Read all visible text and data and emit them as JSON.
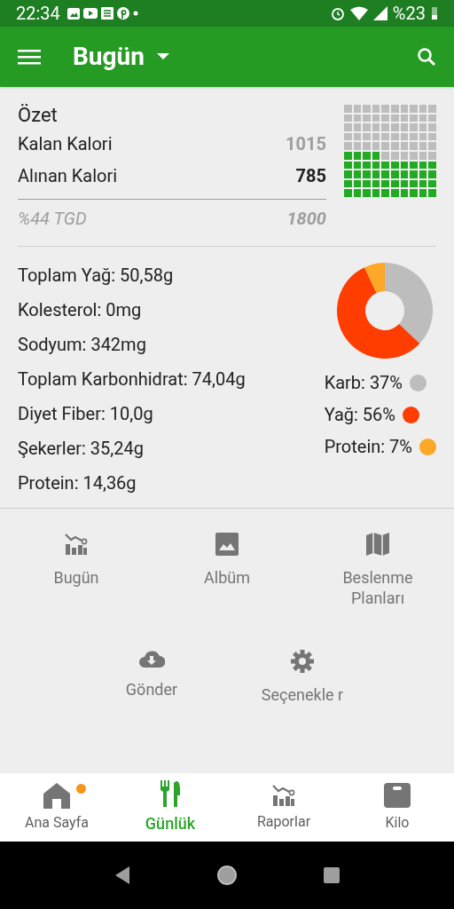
{
  "status_bar": {
    "time": "22:34",
    "battery": "%23"
  },
  "app_bar": {
    "title": "Bugün"
  },
  "summary": {
    "title": "Özet",
    "rows": [
      {
        "label": "Kalan Kalori",
        "value": "1015"
      },
      {
        "label": "Alınan Kalori",
        "value": "785"
      }
    ],
    "footer": {
      "label": "%44 TGD",
      "value": "1800"
    }
  },
  "nutrients": [
    "Toplam Yağ: 50,58g",
    "Kolesterol: 0mg",
    "Sodyum: 342mg",
    "Toplam Karbonhidrat: 74,04g",
    "Diyet Fiber: 10,0g",
    "Şekerler: 35,24g",
    "Protein: 14,36g"
  ],
  "macros": {
    "legend": [
      {
        "text": "Karb: 37%",
        "color": "#bdbdbd"
      },
      {
        "text": "Yağ: 56%",
        "color": "#ff3d00"
      },
      {
        "text": "Protein: 7%",
        "color": "#ffa726"
      }
    ]
  },
  "shortcuts": [
    {
      "label": "Bugün"
    },
    {
      "label": "Albüm"
    },
    {
      "label": "Beslenme Planları"
    },
    {
      "label": "Gönder"
    },
    {
      "label": "Seçenekle r"
    }
  ],
  "bottom_nav": [
    {
      "label": "Ana Sayfa",
      "selected": false,
      "badge": true
    },
    {
      "label": "Günlük",
      "selected": true,
      "badge": false
    },
    {
      "label": "Raporlar",
      "selected": false,
      "badge": false
    },
    {
      "label": "Kilo",
      "selected": false,
      "badge": false
    }
  ]
}
